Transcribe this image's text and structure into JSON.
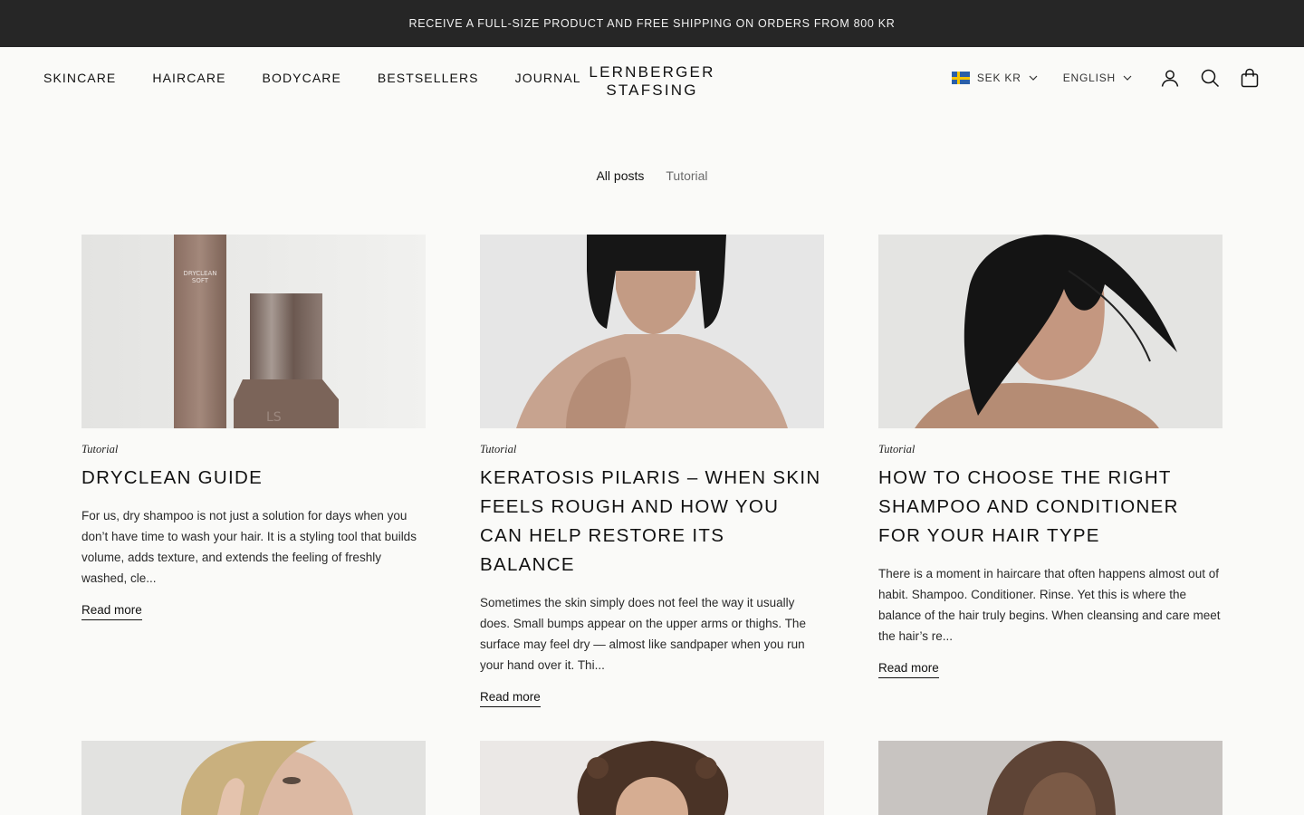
{
  "announcement": "RECEIVE A FULL-SIZE PRODUCT AND FREE SHIPPING ON ORDERS FROM 800 KR",
  "nav": [
    "SKINCARE",
    "HAIRCARE",
    "BODYCARE",
    "BESTSELLERS",
    "JOURNAL"
  ],
  "logo": {
    "line1": "LERNBERGER",
    "line2": "STAFSING"
  },
  "currency": "SEK KR",
  "language": "ENGLISH",
  "icons": {
    "account": "account-icon",
    "search": "search-icon",
    "cart": "bag-icon",
    "flag": "sweden-flag-icon"
  },
  "filters": {
    "all": "All posts",
    "tutorial": "Tutorial"
  },
  "posts": [
    {
      "tag": "Tutorial",
      "title": "DRYCLEAN GUIDE",
      "excerpt": "For us, dry shampoo is not just a solution for days when you don’t have time to wash your hair. It is a styling tool that builds volume, adds texture, and extends the feeling of freshly washed, cle...",
      "read_more": "Read more"
    },
    {
      "tag": "Tutorial",
      "title": "KERATOSIS PILARIS – WHEN SKIN FEELS ROUGH AND HOW YOU CAN HELP RESTORE ITS BALANCE",
      "excerpt": "Sometimes the skin simply does not feel the way it usually does. Small bumps appear on the upper arms or thighs. The surface may feel dry — almost like sandpaper when you run your hand over it. Thi...",
      "read_more": "Read more"
    },
    {
      "tag": "Tutorial",
      "title": "HOW TO CHOOSE THE RIGHT SHAMPOO AND CONDITIONER FOR YOUR HAIR TYPE",
      "excerpt": "There is a moment in haircare that often happens almost out of habit. Shampoo. Conditioner. Rinse. Yet this is where the balance of the hair truly begins. When cleansing and care meet the hair’s re...",
      "read_more": "Read more"
    }
  ]
}
